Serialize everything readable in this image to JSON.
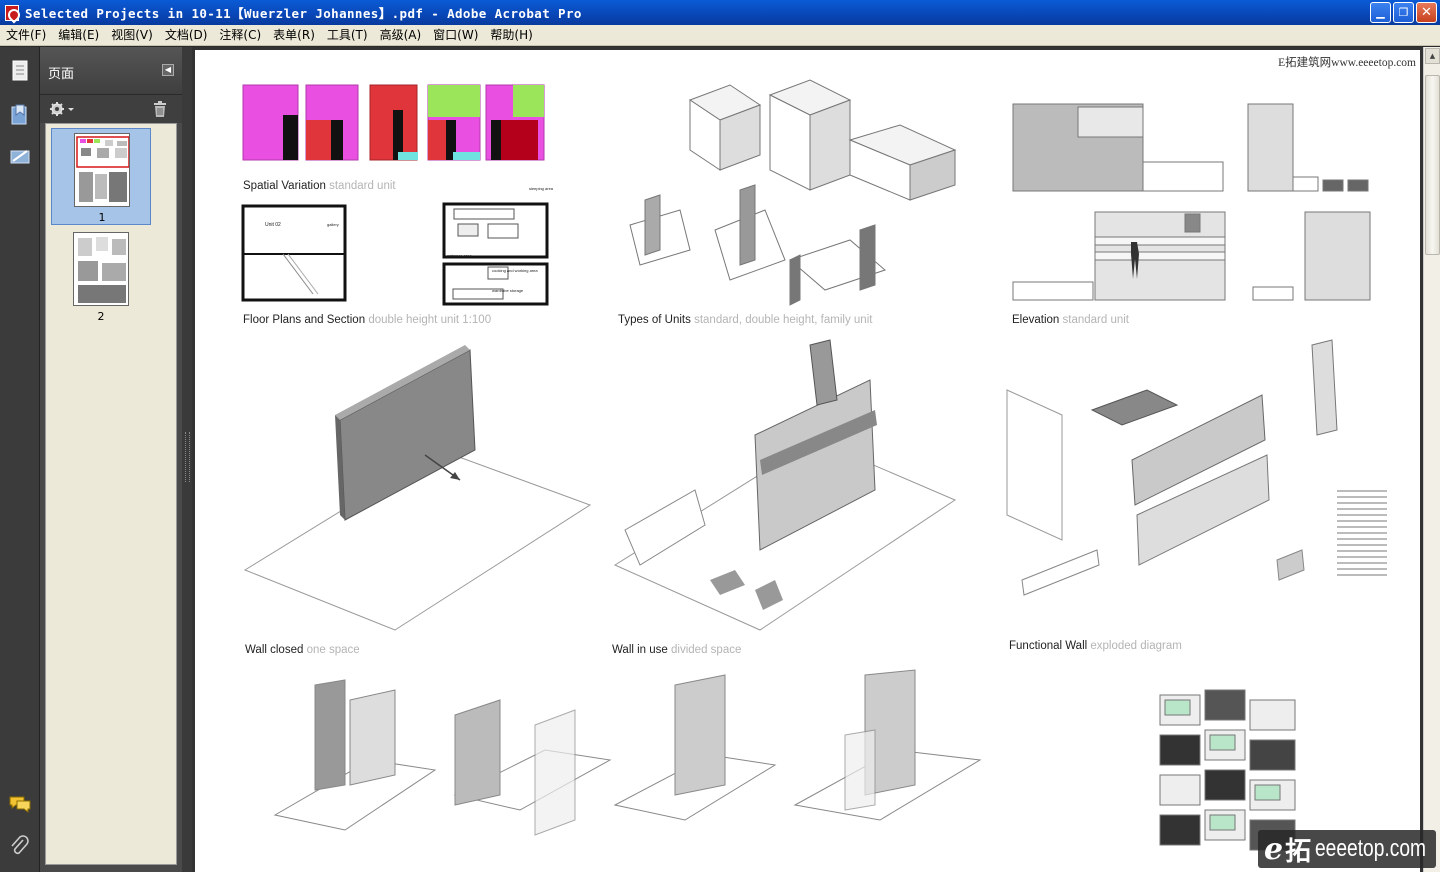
{
  "window": {
    "title": "Selected Projects in 10-11【Wuerzler Johannes】.pdf - Adobe Acrobat Pro"
  },
  "menu": [
    "文件(F)",
    "编辑(E)",
    "视图(V)",
    "文档(D)",
    "注释(C)",
    "表单(R)",
    "工具(T)",
    "高级(A)",
    "窗口(W)",
    "帮助(H)"
  ],
  "panel": {
    "title": "页面",
    "pages": [
      {
        "label": "1",
        "selected": true
      },
      {
        "label": "2",
        "selected": false
      }
    ]
  },
  "page": {
    "watermark_top": "E拓建筑网www.eeeetop.com",
    "captions": [
      {
        "main": "Spatial Variation",
        "sub": "standard unit"
      },
      {
        "main": "Floor Plans and Section",
        "sub": "double height unit 1:100"
      },
      {
        "main": "Types of Units",
        "sub": "standard, double height, family unit"
      },
      {
        "main": "Elevation",
        "sub": "standard unit"
      },
      {
        "main": "Wall closed",
        "sub": "one space"
      },
      {
        "main": "Wall in use",
        "sub": "divided space"
      },
      {
        "main": "Functional Wall",
        "sub": "exploded diagram"
      }
    ],
    "plan_labels": {
      "unit": "Unit 02",
      "gallery": "gallery",
      "sleeping": "sleeping area",
      "entrance": "entrance area",
      "cooking": "cooking and working area",
      "wardrobe": "wardrobe storage"
    },
    "colors": {
      "magenta": "#e94fe0",
      "red": "#e0363b",
      "green": "#9be55a",
      "cyan": "#6fe3e0"
    }
  },
  "watermark_logo": {
    "e": "e",
    "zh": "拓",
    "domain": "eeeetop.com"
  }
}
